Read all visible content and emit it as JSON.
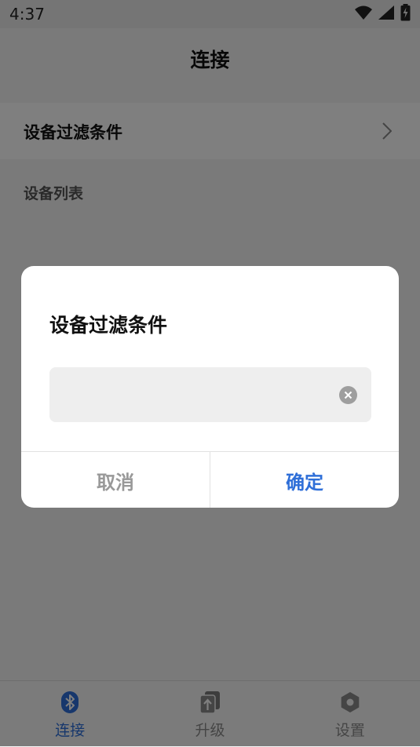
{
  "status_bar": {
    "time": "4:37",
    "icons": [
      "wifi-icon",
      "signal-icon",
      "battery-charging-icon"
    ]
  },
  "header": {
    "title": "连接"
  },
  "filter_row": {
    "label": "设备过滤条件",
    "icon": "chevron-right-icon"
  },
  "device_list": {
    "section_label": "设备列表"
  },
  "dialog": {
    "title": "设备过滤条件",
    "input_value": "",
    "input_placeholder": "",
    "clear_icon": "clear-icon",
    "cancel_label": "取消",
    "confirm_label": "确定"
  },
  "tab_bar": {
    "tabs": [
      {
        "label": "连接",
        "icon": "bluetooth-icon",
        "active": true
      },
      {
        "label": "升级",
        "icon": "upgrade-icon",
        "active": false
      },
      {
        "label": "设置",
        "icon": "settings-icon",
        "active": false
      }
    ]
  },
  "colors": {
    "accent": "#2f6fd8",
    "overlay": "rgba(0,0,0,0.5)"
  }
}
